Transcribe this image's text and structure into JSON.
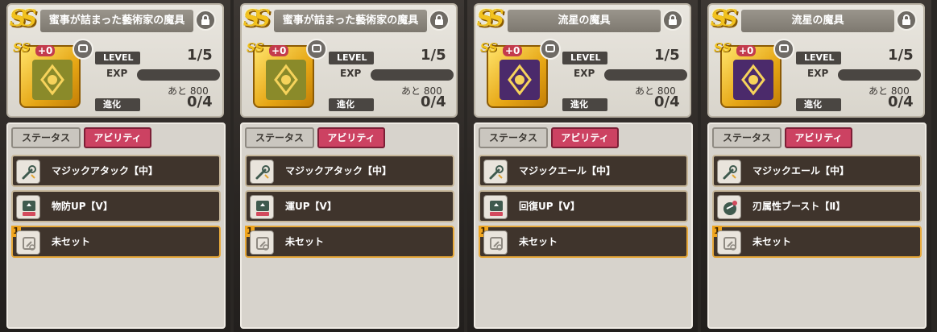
{
  "panels": [
    {
      "rank": "SS",
      "title": "蜜事が詰まった藝術家の魔具",
      "tome_variant": "green",
      "plus": "+0",
      "level_label": "LEVEL",
      "level_value": "1/5",
      "exp_label": "EXP",
      "remain_text": "あと 800",
      "evo_label": "進化",
      "evo_value": "0/4",
      "tab_status": "ステータス",
      "tab_ability": "アビリティ",
      "slots": [
        {
          "label": "マジックアタック【中】",
          "icon": "magic-attack-icon"
        },
        {
          "label": "物防UP【V】",
          "icon": "def-up-icon"
        },
        {
          "label": "未セット",
          "icon": "empty-slot-icon",
          "empty": true,
          "num": "1"
        }
      ]
    },
    {
      "rank": "SS",
      "title": "蜜事が詰まった藝術家の魔具",
      "tome_variant": "green",
      "plus": "+0",
      "level_label": "LEVEL",
      "level_value": "1/5",
      "exp_label": "EXP",
      "remain_text": "あと 800",
      "evo_label": "進化",
      "evo_value": "0/4",
      "tab_status": "ステータス",
      "tab_ability": "アビリティ",
      "slots": [
        {
          "label": "マジックアタック【中】",
          "icon": "magic-attack-icon"
        },
        {
          "label": "運UP【V】",
          "icon": "luck-up-icon"
        },
        {
          "label": "未セット",
          "icon": "empty-slot-icon",
          "empty": true,
          "num": "1"
        }
      ]
    },
    {
      "rank": "SS",
      "title": "流星の魔具",
      "tome_variant": "purple",
      "plus": "+0",
      "level_label": "LEVEL",
      "level_value": "1/5",
      "exp_label": "EXP",
      "remain_text": "あと 800",
      "evo_label": "進化",
      "evo_value": "0/4",
      "tab_status": "ステータス",
      "tab_ability": "アビリティ",
      "slots": [
        {
          "label": "マジックエール【中】",
          "icon": "magic-yell-icon"
        },
        {
          "label": "回復UP【V】",
          "icon": "heal-up-icon"
        },
        {
          "label": "未セット",
          "icon": "empty-slot-icon",
          "empty": true,
          "num": "1"
        }
      ]
    },
    {
      "rank": "SS",
      "title": "流星の魔具",
      "tome_variant": "purple",
      "plus": "+0",
      "level_label": "LEVEL",
      "level_value": "1/5",
      "exp_label": "EXP",
      "remain_text": "あと 800",
      "evo_label": "進化",
      "evo_value": "0/4",
      "tab_status": "ステータス",
      "tab_ability": "アビリティ",
      "slots": [
        {
          "label": "マジックエール【中】",
          "icon": "magic-yell-icon"
        },
        {
          "label": "刃属性ブースト【Ⅱ】",
          "icon": "blade-boost-icon"
        },
        {
          "label": "未セット",
          "icon": "empty-slot-icon",
          "empty": true,
          "num": "1"
        }
      ]
    }
  ],
  "colors": {
    "ability_tab": "#cc4262",
    "slot_bg": "#3f342c",
    "slot_empty_border": "#e7a93b",
    "rank_gold": "#f3c21e",
    "tome_green": "#8a8a2a",
    "tome_purple": "#4b2a6b"
  }
}
